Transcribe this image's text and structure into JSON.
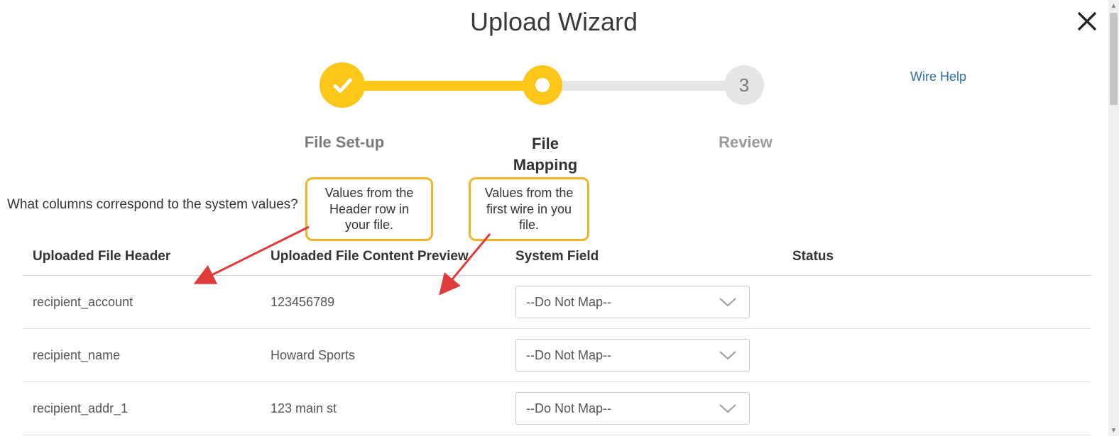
{
  "title": "Upload Wizard",
  "help_link": "Wire Help",
  "stepper": {
    "s1": "File Set-up",
    "s2": "File Mapping",
    "s3": "Review",
    "future_number": "3"
  },
  "question": "What columns correspond to the system values?",
  "callouts": {
    "c1": "Values from the Header row in your file.",
    "c2": "Values from the first wire in you file."
  },
  "table": {
    "headers": {
      "h1": "Uploaded File Header",
      "h2": "Uploaded File Content Preview",
      "h3": "System Field",
      "h4": "Status"
    },
    "default_select": "--Do Not Map--",
    "rows": [
      {
        "header": "recipient_account",
        "preview": "123456789",
        "select": "--Do Not Map--"
      },
      {
        "header": "recipient_name",
        "preview": "Howard Sports",
        "select": "--Do Not Map--"
      },
      {
        "header": "recipient_addr_1",
        "preview": "123 main st",
        "select": "--Do Not Map--"
      }
    ]
  }
}
